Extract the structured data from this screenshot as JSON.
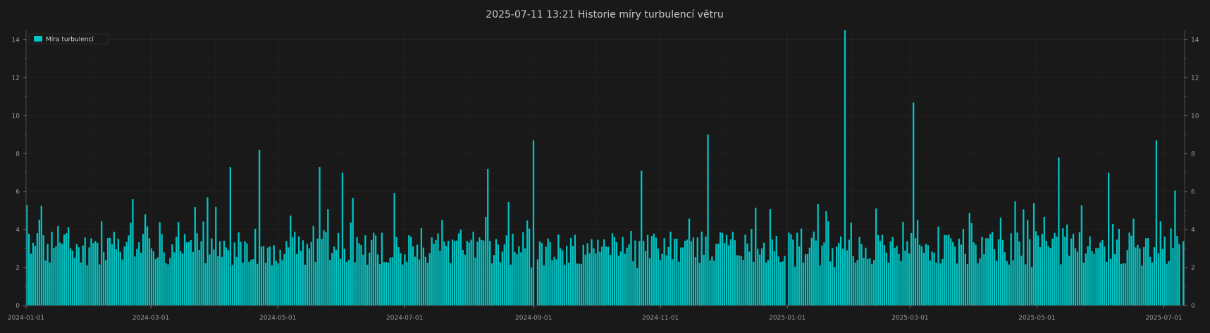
{
  "chart_data": {
    "type": "bar",
    "title": "2025-07-11  13:21  Historie míry turbulencí větru",
    "series": [
      {
        "name": "Míra turbulencí",
        "x_start": "2024-01-01",
        "x_end": "2025-07-11"
      }
    ],
    "xlabel": "",
    "ylabel": "",
    "ylim": [
      0,
      14.5
    ],
    "y_ticks": [
      0,
      2,
      4,
      6,
      8,
      10,
      12,
      14
    ],
    "x_ticks": [
      "2024-01-01",
      "2024-03-01",
      "2024-05-01",
      "2024-07-01",
      "2024-09-01",
      "2024-11-01",
      "2025-01-01",
      "2025-03-01",
      "2025-05-01",
      "2025-07-01"
    ],
    "grid": true,
    "legend_position": "top-left",
    "typical_range": [
      2,
      4
    ],
    "peaks": [
      {
        "x": "2024-01-01",
        "y": 5.3
      },
      {
        "x": "2024-02-21",
        "y": 5.6
      },
      {
        "x": "2024-04-08",
        "y": 7.3
      },
      {
        "x": "2024-04-22",
        "y": 8.2
      },
      {
        "x": "2024-05-21",
        "y": 7.3
      },
      {
        "x": "2024-06-01",
        "y": 7.0
      },
      {
        "x": "2024-08-10",
        "y": 7.2
      },
      {
        "x": "2024-09-01",
        "y": 8.7
      },
      {
        "x": "2024-10-23",
        "y": 7.1
      },
      {
        "x": "2024-11-24",
        "y": 9.0
      },
      {
        "x": "2025-01-29",
        "y": 14.5
      },
      {
        "x": "2025-03-03",
        "y": 10.7
      },
      {
        "x": "2025-05-12",
        "y": 7.8
      },
      {
        "x": "2025-06-05",
        "y": 7.0
      },
      {
        "x": "2025-06-28",
        "y": 8.7
      }
    ],
    "zero_days": [
      "2024-09-02",
      "2025-01-01",
      "2025-07-10"
    ],
    "colors": {
      "background": "#191919",
      "bar": "#00c3c3",
      "grid": "#3a2323",
      "text": "#c8c8c8",
      "tick": "#9a9a9a"
    }
  }
}
